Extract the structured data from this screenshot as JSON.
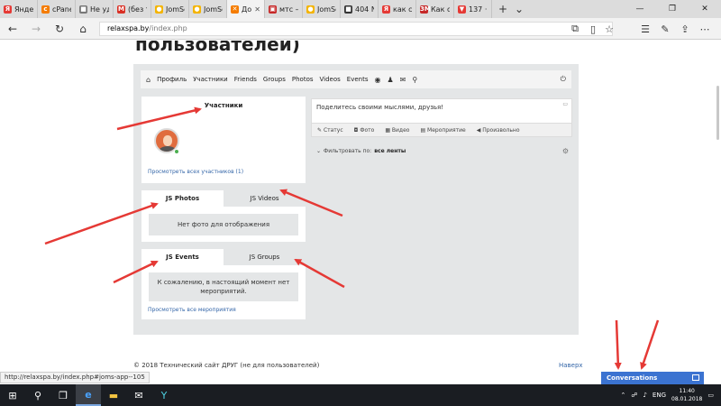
{
  "browser": {
    "tabs": [
      {
        "label": "Яндекс",
        "fav": "Я",
        "color": "#e53935"
      },
      {
        "label": "cPanel",
        "fav": "c",
        "color": "#f57c00"
      },
      {
        "label": "Не уда",
        "fav": "■",
        "color": "#777777"
      },
      {
        "label": "(без те",
        "fav": "M",
        "color": "#d93025"
      },
      {
        "label": "JomSo",
        "fav": "●",
        "color": "#f4b400"
      },
      {
        "label": "JomSo",
        "fav": "●",
        "color": "#f4b400"
      },
      {
        "label": "До",
        "fav": "✕",
        "color": "#f57c00",
        "active": true
      },
      {
        "label": "мтс —",
        "fav": "▣",
        "color": "#c62828"
      },
      {
        "label": "JomSo",
        "fav": "●",
        "color": "#f4b400"
      },
      {
        "label": "404 Nc",
        "fav": "■",
        "color": "#333333"
      },
      {
        "label": "как со",
        "fav": "Я",
        "color": "#e53935"
      },
      {
        "label": "Как сд",
        "fav": "3M",
        "color": "#c62828"
      },
      {
        "label": "137 · В",
        "fav": "▼",
        "color": "#e53935"
      }
    ],
    "url_host": "relaxspa.by",
    "url_path": "/index.php",
    "status_url": "http://relaxspa.by/index.php#joms-app--105"
  },
  "page": {
    "heading": "пользователей)",
    "toolbar": [
      "Профиль",
      "Участники",
      "Friends",
      "Groups",
      "Photos",
      "Videos",
      "Events"
    ],
    "members": {
      "title": "Участники",
      "view_all": "Просмотреть всех участников (1)"
    },
    "photos_videos": {
      "tab_photos": "JS Photos",
      "tab_videos": "JS Videos",
      "empty": "Нет фото для отображения"
    },
    "events_groups": {
      "tab_events": "JS Events",
      "tab_groups": "JS Groups",
      "empty_line1": "К сожалению, в настоящий момент нет",
      "empty_line2": "мероприятий.",
      "view_all": "Просмотреть все мероприятия"
    },
    "share": {
      "placeholder": "Поделитесь своими мыслями, друзья!",
      "status": "Статус",
      "photo": "Фото",
      "video": "Видео",
      "event": "Мероприятие",
      "custom": "Произвольно"
    },
    "filter": {
      "label": "Фильтровать по:",
      "value": "все ленты"
    },
    "footer": "© 2018 Технический сайт ДРУГ (не для пользователей)",
    "back_to_top": "Наверх",
    "conversations": "Conversations"
  },
  "taskbar": {
    "lang": "ENG",
    "time": "11:40",
    "date": "08.01.2018"
  },
  "colors": {
    "accent": "#3b73d1",
    "arrow": "#e53935"
  }
}
